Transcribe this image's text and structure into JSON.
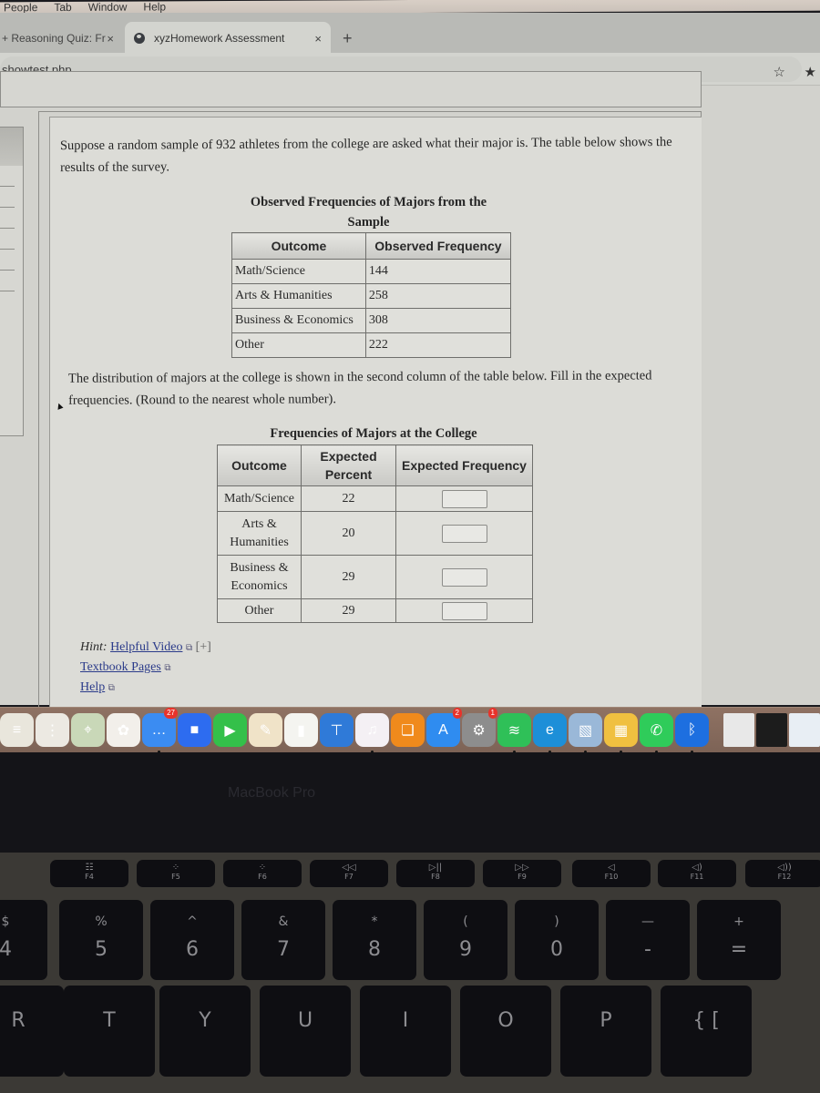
{
  "menubar": {
    "items": [
      "People",
      "Tab",
      "Window",
      "Help"
    ]
  },
  "browser": {
    "tabs": [
      {
        "label": "+ Reasoning Quiz: Fr",
        "active": false,
        "close": "×"
      },
      {
        "label": "xyzHomework Assessment",
        "active": true,
        "close": "×"
      }
    ],
    "new_tab": "+",
    "url": "showtest.php",
    "bookmark_icon": "☆",
    "extension_icon": "★"
  },
  "question": {
    "intro": "Suppose a random sample of 932 athletes from the college are asked what their major is. The table below shows the results of the survey.",
    "observed_table": {
      "caption": "Observed Frequencies of Majors from the Sample",
      "headers": [
        "Outcome",
        "Observed Frequency"
      ],
      "rows": [
        {
          "outcome": "Math/Science",
          "observed": "144"
        },
        {
          "outcome": "Arts & Humanities",
          "observed": "258"
        },
        {
          "outcome": "Business & Economics",
          "observed": "308"
        },
        {
          "outcome": "Other",
          "observed": "222"
        }
      ]
    },
    "instruction": "The distribution of majors at the college is shown in the second column of the table below.   Fill in the expected frequencies. (Round to the nearest whole number).",
    "expected_table": {
      "caption": "Frequencies of Majors at the College",
      "headers": [
        "Outcome",
        "Expected Percent",
        "Expected Frequency"
      ],
      "rows": [
        {
          "outcome": "Math/Science",
          "percent": "22",
          "answer": ""
        },
        {
          "outcome": "Arts & Humanities",
          "percent": "20",
          "answer": ""
        },
        {
          "outcome": "Business & Economics",
          "percent": "29",
          "answer": ""
        },
        {
          "outcome": "Other",
          "percent": "29",
          "answer": ""
        }
      ]
    },
    "hint": {
      "label": "Hint:",
      "video_link": "Helpful Video",
      "expand": "[+]",
      "textbook_link": "Textbook Pages",
      "help_link": "Help",
      "external_icon": "⧉"
    }
  },
  "dock": {
    "apps": [
      {
        "name": "notes",
        "color": "#e9e6dc",
        "glyph": "≡"
      },
      {
        "name": "reminders",
        "color": "#ece9e2",
        "glyph": "⋮"
      },
      {
        "name": "maps",
        "color": "#c9d8b8",
        "glyph": "⌖"
      },
      {
        "name": "photos",
        "color": "#f2efea",
        "glyph": "✿"
      },
      {
        "name": "messages",
        "color": "#3b8cf2",
        "glyph": "…",
        "badge": "27",
        "running": true
      },
      {
        "name": "zoom",
        "color": "#2d6cf0",
        "glyph": "■"
      },
      {
        "name": "facetime",
        "color": "#34c04a",
        "glyph": "▶"
      },
      {
        "name": "pages",
        "color": "#f0e3c8",
        "glyph": "✎"
      },
      {
        "name": "numbers",
        "color": "#f4f4f0",
        "glyph": "▮"
      },
      {
        "name": "keynote",
        "color": "#2f7ad8",
        "glyph": "⊤"
      },
      {
        "name": "music",
        "color": "#f4f0f4",
        "glyph": "♫",
        "running": true
      },
      {
        "name": "books",
        "color": "#f08a1c",
        "glyph": "❑"
      },
      {
        "name": "app-store",
        "color": "#2f8cf0",
        "glyph": "A",
        "badge": "2"
      },
      {
        "name": "system-preferences",
        "color": "#8d8d8d",
        "glyph": "⚙",
        "badge": "1"
      },
      {
        "name": "spotify",
        "color": "#2fc058",
        "glyph": "≋",
        "running": true
      },
      {
        "name": "edge",
        "color": "#1d8fd8",
        "glyph": "e",
        "running": true
      },
      {
        "name": "preview",
        "color": "#9ab8d8",
        "glyph": "▧",
        "running": true
      },
      {
        "name": "image-viewer",
        "color": "#f0c040",
        "glyph": "▦",
        "running": true
      },
      {
        "name": "whatsapp",
        "color": "#2fcc5a",
        "glyph": "✆",
        "running": true
      },
      {
        "name": "bluetooth",
        "color": "#1d6fe0",
        "glyph": "ᛒ",
        "running": true
      }
    ],
    "recent": [
      {
        "name": "recent-document-1",
        "color": "#e8e8e8"
      },
      {
        "name": "recent-document-2",
        "color": "#1c1c1c"
      },
      {
        "name": "recent-document-3",
        "color": "#e8eef4"
      }
    ]
  },
  "device": {
    "brand": "MacBook Pro",
    "function_keys": [
      {
        "glyph": "☷",
        "label": "F4"
      },
      {
        "glyph": "⁘",
        "label": "F5"
      },
      {
        "glyph": "⁘",
        "label": "F6"
      },
      {
        "glyph": "◁◁",
        "label": "F7"
      },
      {
        "glyph": "▷||",
        "label": "F8"
      },
      {
        "glyph": "▷▷",
        "label": "F9"
      },
      {
        "glyph": "◁",
        "label": "F10"
      },
      {
        "glyph": "◁)",
        "label": "F11"
      },
      {
        "glyph": "◁))",
        "label": "F12"
      }
    ],
    "number_keys": [
      {
        "shift": "$",
        "main": "4"
      },
      {
        "shift": "%",
        "main": "5"
      },
      {
        "shift": "^",
        "main": "6"
      },
      {
        "shift": "&",
        "main": "7"
      },
      {
        "shift": "*",
        "main": "8"
      },
      {
        "shift": "(",
        "main": "9"
      },
      {
        "shift": ")",
        "main": "0"
      },
      {
        "shift": "—",
        "main": "-"
      },
      {
        "shift": "+",
        "main": "="
      }
    ],
    "letter_keys": [
      "R",
      "T",
      "Y",
      "U",
      "I",
      "O",
      "P",
      "{ ["
    ]
  }
}
